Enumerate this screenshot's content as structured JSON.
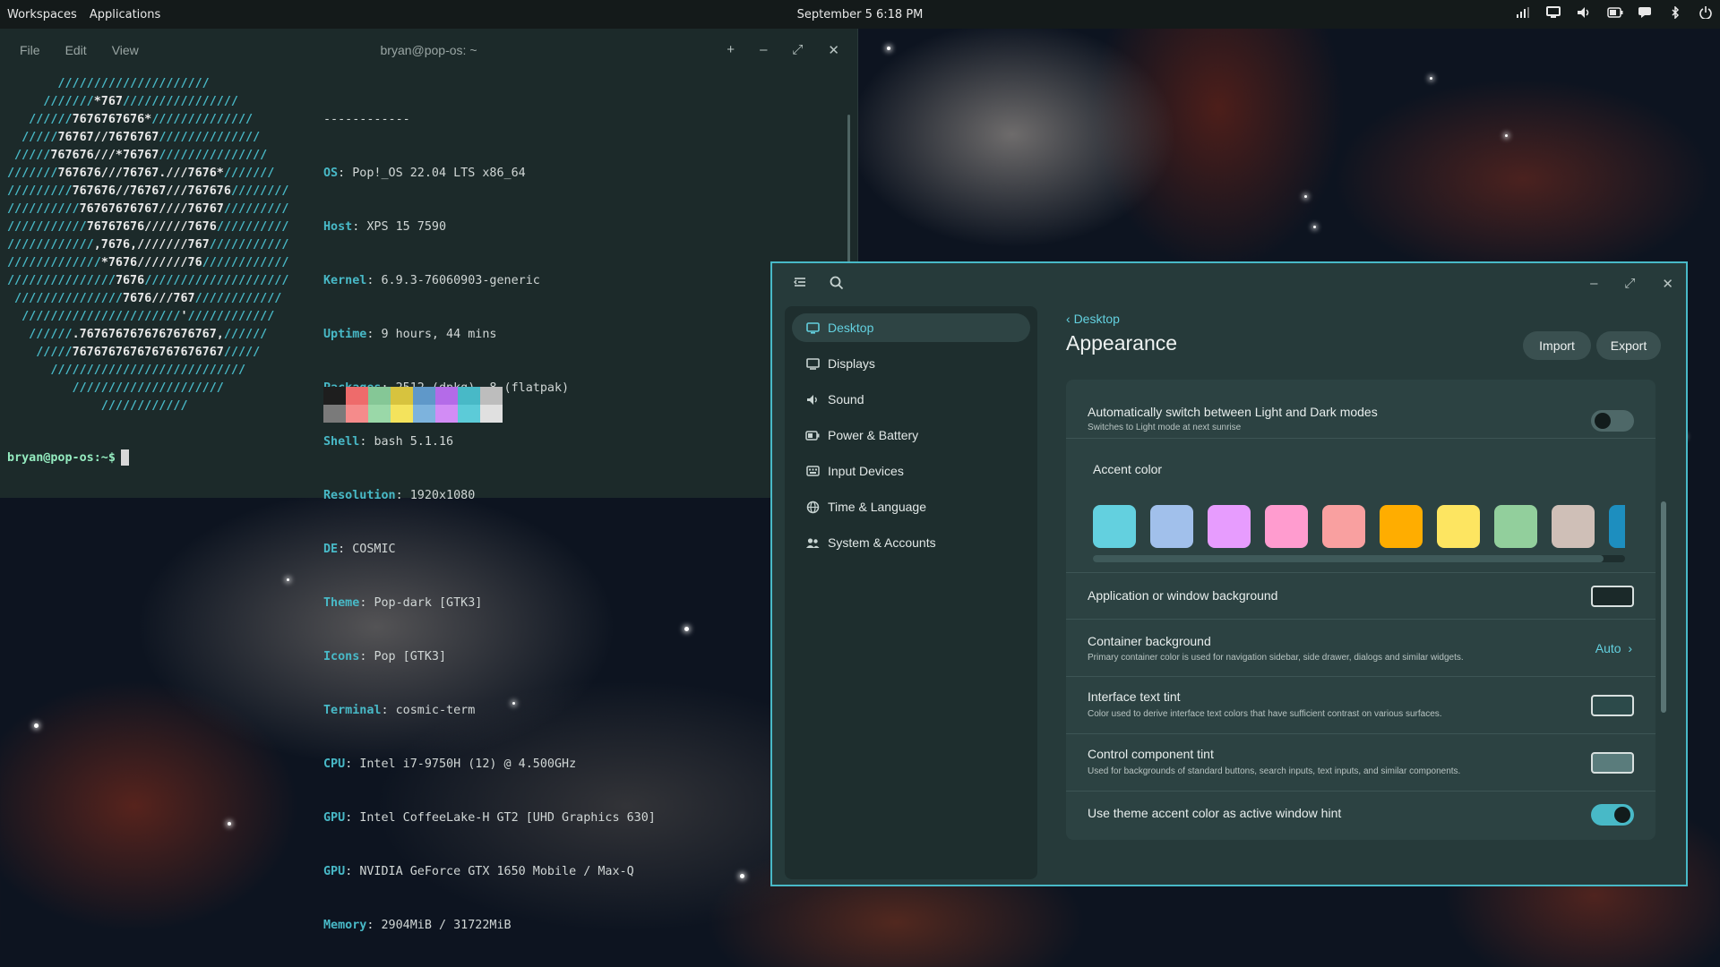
{
  "top_panel": {
    "workspaces": "Workspaces",
    "applications": "Applications",
    "clock": "September 5 6:18 PM",
    "tray_icons": [
      "network-icon",
      "display-icon",
      "volume-icon",
      "battery-icon",
      "notifications-icon",
      "bluetooth-icon",
      "power-icon"
    ]
  },
  "terminal": {
    "menu": [
      "File",
      "Edit",
      "View"
    ],
    "title": "bryan@pop-os: ~",
    "controls": {
      "new_tab": "+",
      "minimize": "–",
      "maximize": "⤢",
      "close": "✕"
    },
    "separator": "------------",
    "info": [
      {
        "key": "OS",
        "value": "Pop!_OS 22.04 LTS x86_64"
      },
      {
        "key": "Host",
        "value": "XPS 15 7590"
      },
      {
        "key": "Kernel",
        "value": "6.9.3-76060903-generic"
      },
      {
        "key": "Uptime",
        "value": "9 hours, 44 mins"
      },
      {
        "key": "Packages",
        "value": "2512 (dpkg), 8 (flatpak)"
      },
      {
        "key": "Shell",
        "value": "bash 5.1.16"
      },
      {
        "key": "Resolution",
        "value": "1920x1080"
      },
      {
        "key": "DE",
        "value": "COSMIC"
      },
      {
        "key": "Theme",
        "value": "Pop-dark [GTK3]"
      },
      {
        "key": "Icons",
        "value": "Pop [GTK3]"
      },
      {
        "key": "Terminal",
        "value": "cosmic-term"
      },
      {
        "key": "CPU",
        "value": "Intel i7-9750H (12) @ 4.500GHz"
      },
      {
        "key": "GPU",
        "value": "Intel CoffeeLake-H GT2 [UHD Graphics 630]"
      },
      {
        "key": "GPU",
        "value": "NVIDIA GeForce GTX 1650 Mobile / Max-Q"
      },
      {
        "key": "Memory",
        "value": "2904MiB / 31722MiB"
      }
    ],
    "palette_dark": [
      "#1e1e1e",
      "#ee6b6b",
      "#85c796",
      "#d7c33e",
      "#5f98c9",
      "#b46be8",
      "#48b9c7",
      "#bdbdbd"
    ],
    "palette_light": [
      "#7a7a7a",
      "#f58b8b",
      "#9ad8a8",
      "#f4e35c",
      "#7db3dd",
      "#d28cf5",
      "#5ccbd8",
      "#e0e0e0"
    ],
    "prompt": "bryan@pop-os:~$"
  },
  "settings": {
    "nav": [
      {
        "label": "Desktop",
        "icon": "desktop-icon",
        "active": true
      },
      {
        "label": "Displays",
        "icon": "displays-icon"
      },
      {
        "label": "Sound",
        "icon": "sound-icon"
      },
      {
        "label": "Power & Battery",
        "icon": "battery-icon"
      },
      {
        "label": "Input Devices",
        "icon": "keyboard-icon"
      },
      {
        "label": "Time & Language",
        "icon": "globe-icon"
      },
      {
        "label": "System & Accounts",
        "icon": "users-icon"
      }
    ],
    "back_label": "Desktop",
    "page_title": "Appearance",
    "import_label": "Import",
    "export_label": "Export",
    "auto_switch": {
      "title": "Automatically switch between Light and Dark modes",
      "subtitle": "Switches to Light mode at next sunrise",
      "enabled": false
    },
    "accent_color": {
      "label": "Accent color",
      "colors": [
        "#63d0df",
        "#a1c0eb",
        "#e79cfe",
        "#ff9ccf",
        "#f9a0a0",
        "#ffad00",
        "#fde561",
        "#92cf9c",
        "#cfbfb7",
        "#1d8ebf"
      ]
    },
    "app_background": {
      "title": "Application or window background",
      "color": "#1b2929"
    },
    "container_background": {
      "title": "Container background",
      "subtitle": "Primary container color is used for navigation sidebar, side drawer, dialogs and similar widgets.",
      "value": "Auto"
    },
    "text_tint": {
      "title": "Interface text tint",
      "subtitle": "Color used to derive interface text colors that have sufficient contrast on various surfaces.",
      "color": "#2c4a4a"
    },
    "control_tint": {
      "title": "Control component tint",
      "subtitle": "Used for backgrounds of standard buttons, search inputs, text inputs, and similar components.",
      "color": "#5a7c7c"
    },
    "accent_hint": {
      "title": "Use theme accent color as active window hint",
      "enabled": true
    }
  }
}
